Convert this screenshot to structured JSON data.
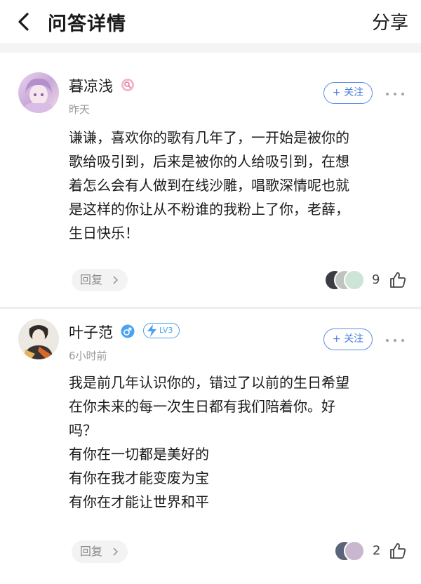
{
  "header": {
    "title": "问答详情",
    "share_label": "分享"
  },
  "comments": [
    {
      "username": "暮凉浅",
      "time": "昨天",
      "follow_label": "+ 关注",
      "lines": [
        "谦谦，喜欢你的歌有几年了，一开始是被你的",
        "歌给吸引到，后来是被你的人给吸引到，在想",
        "着怎么会有人做到在线沙雕，唱歌深情呢也就",
        "是这样的你让从不粉谁的我粉上了你，老薛，",
        "生日快乐！"
      ],
      "reply_label": "回复",
      "like_count": "9"
    },
    {
      "username": "叶子范",
      "time": "6小时前",
      "level": "LV3",
      "follow_label": "+ 关注",
      "lines": [
        "我是前几年认识你的，错过了以前的生日希望",
        "在你未来的每一次生日都有我们陪着你。好",
        "吗？",
        "有你在一切都是美好的",
        "有你在我才能变废为宝",
        "有你在才能让世界和平"
      ],
      "reply_label": "回复",
      "like_count": "2"
    }
  ],
  "colors": {
    "accent": "#4a7fe0",
    "level_badge": "#4aa3ef",
    "gender_male": "#4aa3ef",
    "verified_badge": "#e58ab0"
  },
  "icons": [
    "back-chevron-icon",
    "more-dots-icon",
    "chevron-right-icon",
    "thumbs-up-icon",
    "male-icon",
    "lightning-icon",
    "verified-badge-icon"
  ]
}
